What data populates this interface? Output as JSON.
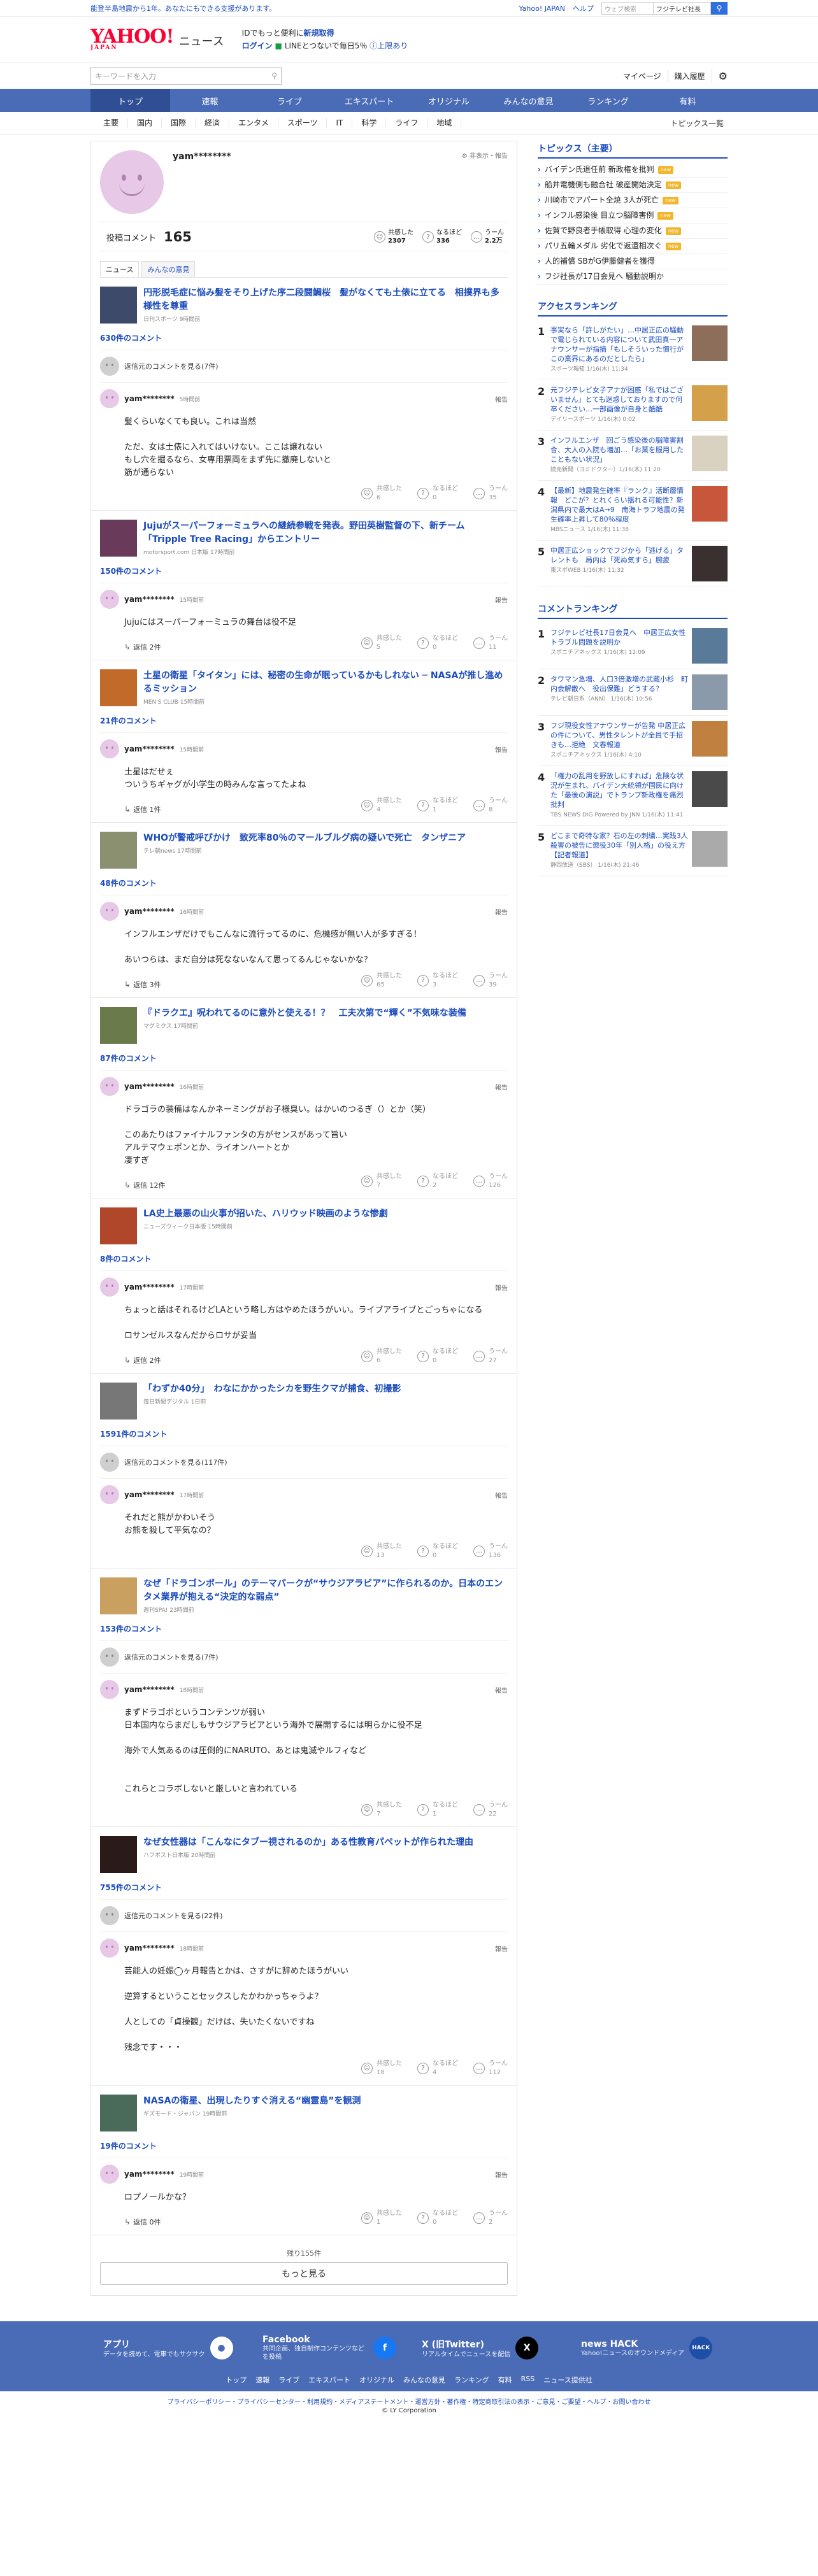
{
  "topbar": {
    "notice": "能登半島地震から1年。あなたにもできる支援があります。",
    "links": [
      "Yahoo! JAPAN",
      "ヘルプ"
    ],
    "search_placeholder": "ウェブ検索",
    "search_select": "フジテレビ社長"
  },
  "header": {
    "logo": "YAHOO!",
    "logo_sub": "JAPAN",
    "service": "ニュース",
    "promo_line1_a": "IDでもっと便利に",
    "promo_line1_b": "新規取得",
    "promo_line2_a": "ログイン",
    "promo_line2_b": "LINEとつないで毎日5％",
    "promo_line2_c": "上限あり"
  },
  "searchbar": {
    "placeholder": "キーワードを入力",
    "mypage": "マイページ",
    "purchased": "購入履歴"
  },
  "gnav": [
    "トップ",
    "速報",
    "ライブ",
    "エキスパート",
    "オリジナル",
    "みんなの意見",
    "ランキング",
    "有料"
  ],
  "snav": [
    "主要",
    "国内",
    "国際",
    "経済",
    "エンタメ",
    "スポーツ",
    "IT",
    "科学",
    "ライフ",
    "地域"
  ],
  "snav_more": "トピックス一覧",
  "profile": {
    "name": "yam********",
    "links": "非表示・報告",
    "post_label": "投稿コメント",
    "post_count": "165",
    "stats": [
      {
        "icon": "☺",
        "label": "共感した",
        "value": "2307"
      },
      {
        "icon": "?",
        "label": "なるほど",
        "value": "336"
      },
      {
        "icon": "…",
        "label": "うーん",
        "value": "2.2万"
      }
    ],
    "tabs": [
      "ニュース",
      "みんなの意見"
    ]
  },
  "entries": [
    {
      "title": "円形脱毛症に悩み髪をそり上げた序二段闘鯛桜　髪がなくても土俵に立てる　相撲界も多様性を尊重",
      "source": "日刊スポーツ",
      "time": "9時間前",
      "comment_count": "630件のコメント",
      "prev_replies": "返信元のコメントを見る(7件)",
      "user": "yam********",
      "ctime": "5時間前",
      "body": [
        "髪くらいなくても良い。これは当然",
        "",
        "ただ、女は土俵に入れてはいけない。ここは譲れない",
        "もし穴を掘るなら、女専用票両をまず先に撤廃しないと",
        "筋が通らない"
      ],
      "reply": "",
      "reactions": [
        "6",
        "0",
        "35"
      ]
    },
    {
      "title": "Jujuがスーパーフォーミュラへの継続参戦を発表。野田英樹監督の下、新チーム「Tripple Tree Racing」からエントリー",
      "source": "motorsport.com 日本版",
      "time": "17時間前",
      "comment_count": "150件のコメント",
      "prev_replies": "",
      "user": "yam********",
      "ctime": "15時間前",
      "body": [
        "Jujuにはスーパーフォーミュラの舞台は役不足"
      ],
      "reply": "返信 2件",
      "reactions": [
        "5",
        "0",
        "11"
      ]
    },
    {
      "title": "土星の衛星「タイタン」には、秘密の生命が眠っているかもしれない ─ NASAが推し進めるミッション",
      "source": "MEN'S CLUB",
      "time": "15時間前",
      "comment_count": "21件のコメント",
      "prev_replies": "",
      "user": "yam********",
      "ctime": "15時間前",
      "body": [
        "土星はだせぇ",
        "ついうちギャグが小学生の時みんな言ってたよね"
      ],
      "reply": "返信 1件",
      "reactions": [
        "4",
        "1",
        "8"
      ]
    },
    {
      "title": "WHOが警戒呼びかけ　致死率80％のマールブルグ病の疑いで死亡　タンザニア",
      "source": "テレ朝news",
      "time": "17時間前",
      "comment_count": "48件のコメント",
      "prev_replies": "",
      "user": "yam********",
      "ctime": "16時間前",
      "body": [
        "インフルエンザだけでもこんなに流行ってるのに、危機感が無い人が多すぎる！",
        "",
        "あいつらは、まだ自分は死なないなんて思ってるんじゃないかな？"
      ],
      "reply": "返信 3件",
      "reactions": [
        "65",
        "3",
        "39"
      ]
    },
    {
      "title": "『ドラクエ』呪われてるのに意外と使える！？　工夫次第で“輝く”不気味な装備",
      "source": "マグミクス",
      "time": "17時間前",
      "comment_count": "87件のコメント",
      "prev_replies": "",
      "user": "yam********",
      "ctime": "16時間前",
      "body": [
        "ドラゴラの装備はなんかネーミングがお子様臭い。はかいのつるぎ（）とか（笑）",
        "",
        "このあたりはファイナルファンタの方がセンスがあって旨い",
        "アルテマウェポンとか、ライオンハートとか",
        "凄すぎ"
      ],
      "reply": "返信 12件",
      "reactions": [
        "7",
        "2",
        "126"
      ]
    },
    {
      "title": "LA史上最悪の山火事が招いた、ハリウッド映画のような惨劇",
      "source": "ニューズウィーク日本版",
      "time": "15時間前",
      "comment_count": "8件のコメント",
      "prev_replies": "",
      "user": "yam********",
      "ctime": "17時間前",
      "body": [
        "ちょっと話はそれるけどLAという略し方はやめたほうがいい。ライブアライブとごっちゃになる",
        "",
        "ロサンゼルスなんだからロサが妥当"
      ],
      "reply": "返信 2件",
      "reactions": [
        "6",
        "0",
        "27"
      ]
    },
    {
      "title": "「わずか40分」　わなにかかったシカを野生クマが捕食、初撮影",
      "source": "毎日新聞デジタル",
      "time": "1日前",
      "comment_count": "1591件のコメント",
      "prev_replies": "返信元のコメントを見る(117件)",
      "user": "yam********",
      "ctime": "17時間前",
      "body": [
        "それだと熊がかわいそう",
        "お熊を殺して平気なの？"
      ],
      "reply": "",
      "reactions": [
        "13",
        "0",
        "136"
      ]
    },
    {
      "title": "なぜ「ドラゴンボール」のテーマパークが“サウジアラビア”に作られるのか。日本のエンタメ業界が抱える“決定的な弱点”",
      "source": "週刊SPA!",
      "time": "23時間前",
      "comment_count": "153件のコメント",
      "prev_replies": "返信元のコメントを見る(7件)",
      "user": "yam********",
      "ctime": "18時間前",
      "body": [
        "まずドラゴボというコンテンツが弱い",
        "日本国内ならまだしもサウジアラビアという海外で展開するには明らかに役不足",
        "",
        "海外で人気あるのは圧倒的にNARUTO、あとは鬼滅やルフィなど",
        "",
        "",
        "これらとコラボしないと厳しいと言われている"
      ],
      "reply": "",
      "reactions": [
        "7",
        "1",
        "22"
      ]
    },
    {
      "title": "なぜ女性器は「こんなにタブー視されるのか」ある性教育パペットが作られた理由",
      "source": "ハフポスト日本版",
      "time": "20時間前",
      "comment_count": "755件のコメント",
      "prev_replies": "返信元のコメントを見る(22件)",
      "user": "yam********",
      "ctime": "18時間前",
      "body": [
        "芸能人の妊娠◯ヶ月報告とかは、さすがに辞めたほうがいい",
        "",
        "逆算するということセックスしたかわかっちゃうよ？",
        "",
        "人としての「貞操観」だけは、失いたくないですね",
        "",
        "残念です・・・"
      ],
      "reply": "",
      "reactions": [
        "18",
        "4",
        "112"
      ]
    },
    {
      "title": "NASAの衛星、出現したりすぐ消える“幽霊島”を観測",
      "source": "ギズモード・ジャパン",
      "time": "19時間前",
      "comment_count": "19件のコメント",
      "prev_replies": "",
      "user": "yam********",
      "ctime": "19時間前",
      "body": [
        "ロプノールかな？"
      ],
      "reply": "返信 0件",
      "reactions": [
        "1",
        "0",
        "2"
      ]
    }
  ],
  "reaction_labels": [
    "共感した",
    "なるほど",
    "うーん"
  ],
  "report_label": "報告",
  "list_footer": "残り155件",
  "more_button": "もっと見る",
  "sidebar": {
    "topics_title": "トピックス（主要）",
    "topics": [
      {
        "text": "バイデン氏退任前 新政権を批判",
        "badge": "new"
      },
      {
        "text": "船井電機側も融合社 破産開始決定",
        "badge": "new"
      },
      {
        "text": "川崎市でアパート全焼 3人が死亡",
        "badge": "new"
      },
      {
        "text": "インフル感染後 目立つ脳障害例",
        "badge": "new"
      },
      {
        "text": "佐賀で野良者手帳取得 心理の変化",
        "badge": "new"
      },
      {
        "text": "パリ五輪メダル 劣化で返還相次ぐ",
        "badge": "new"
      },
      {
        "text": "人的補償 SBがG伊藤健者を獲得",
        "badge": ""
      },
      {
        "text": "フジ社長が17日会見へ 騒動説明か",
        "badge": ""
      }
    ],
    "access_title": "アクセスランキング",
    "access": [
      {
        "rank": "1",
        "text": "事実なら「許しがたい」…中居正広の騒動で電じられている内容について武田真一アナウンサーが指摘「もしそういった慣行がこの業界にあるのだとしたら」",
        "src": "スポーツ報知 1/16(木) 11:34",
        "color": "#8c6e5a"
      },
      {
        "rank": "2",
        "text": "元フジテレビ女子アナが困惑「私ではございません」とても迷惑しておりますので何卒ください…一部画像が自身と酷酷",
        "src": "デイリースポーツ 1/16(木) 0:02",
        "color": "#d4a14a"
      },
      {
        "rank": "3",
        "text": "インフルエンザ　回ごう感染後の脳障害割合、大人の入院も増加…「お薬を服用したこともない状況」",
        "src": "読売新聞（ヨミドクター）1/16(木) 11:20",
        "color": "#d9d2c0"
      },
      {
        "rank": "4",
        "text": "【最新】地震発生確率『ランク』活断層情報　どこが？とれくらい揺れる可能性？新潟県内で最大はA→9　南海トラフ地震の発生確率上昇して80％程度",
        "src": "MBSニュース 1/16(木) 11:38",
        "color": "#c7563b"
      },
      {
        "rank": "5",
        "text": "中居正広ショックでフジから「逃げる」タレントも　局内は「死ぬ気すら」腕疲",
        "src": "東スポWEB 1/16(木) 11:32",
        "color": "#3b3030"
      }
    ],
    "comment_title": "コメントランキング",
    "comment_rank": [
      {
        "rank": "1",
        "text": "フジテレビ社長17日会見へ　中居正広女性トラブル問題を説明か",
        "src": "スポニチアネックス 1/16(木) 12:09",
        "color": "#5a7a9a"
      },
      {
        "rank": "2",
        "text": "タワマン急増、人口3倍激増の武蔵小杉　町内会解散へ　役出保難」どうする？",
        "src": "テレビ朝日系（ANN） 1/16(木) 10:56",
        "color": "#8a9aaa"
      },
      {
        "rank": "3",
        "text": "フジ現役女性アナウンサーが告発 中居正広の件について、男性タレントが全員で手招きも…拒絶　文春報道",
        "src": "スポニチアネックス 1/16(木) 4:10",
        "color": "#c08040"
      },
      {
        "rank": "4",
        "text": "「権力の乱用を野放しにすれば」危険な状況が生まれ、バイデン大統領が国民に向けた「最後の演説」でトランプ新政権を痛烈批判",
        "src": "TBS NEWS DIG Powered by JNN 1/16(木) 11:41",
        "color": "#4a4a4a"
      },
      {
        "rank": "5",
        "text": "どこまで奇特な家？石の左の刺繍…実践3人殺害の被告に懲役30年「別人格」の役え方【記者報道】",
        "src": "静岡放送（SBS） 1/16(木) 21:46",
        "color": "#aaa"
      }
    ]
  },
  "footer": {
    "cols": [
      {
        "title": "アプリ",
        "desc": "データを読めて、電車でもサクサク",
        "icon": "●",
        "color": "#ffffff"
      },
      {
        "title": "Facebook",
        "desc": "共同企画、独自制作コンテンツなどを投稿",
        "icon": "f",
        "color": "#1877f2"
      },
      {
        "title": "X (旧Twitter)",
        "desc": "リアルタイムでニュースを配信",
        "icon": "X",
        "color": "#000000"
      },
      {
        "title": "news HACK",
        "desc": "Yahoo!ニュースのオウンドメディア",
        "icon": "HACK",
        "color": "#1d4fa8"
      }
    ],
    "nav": [
      "トップ",
      "速報",
      "ライブ",
      "エキスパート",
      "オリジナル",
      "みんなの意見",
      "ランキング",
      "有料",
      "RSS",
      "ニュース提供社"
    ],
    "links": "プライバシーポリシー・プライバシーセンター・利用規約・メディアステートメント・運営方針・著作権・特定商取引法の表示・ご意見・ご要望・ヘルプ・お問い合わせ",
    "copyright": "© LY Corporation"
  }
}
